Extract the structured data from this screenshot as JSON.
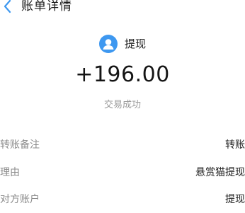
{
  "header": {
    "back_icon": "chevron-left-icon",
    "title": "账单详情"
  },
  "transaction": {
    "type_icon": "user-avatar-icon",
    "type_label": "提现",
    "amount": "+196.00",
    "status": "交易成功"
  },
  "details": [
    {
      "label": "转账备注",
      "value": "转账"
    },
    {
      "label": "理由",
      "value": "悬赏猫提现"
    },
    {
      "label": "对方账户",
      "value": "提现"
    }
  ],
  "colors": {
    "accent": "#3e98f0",
    "text_primary": "#222222",
    "text_secondary": "#8c8c8c",
    "status": "#9a9a9a"
  }
}
